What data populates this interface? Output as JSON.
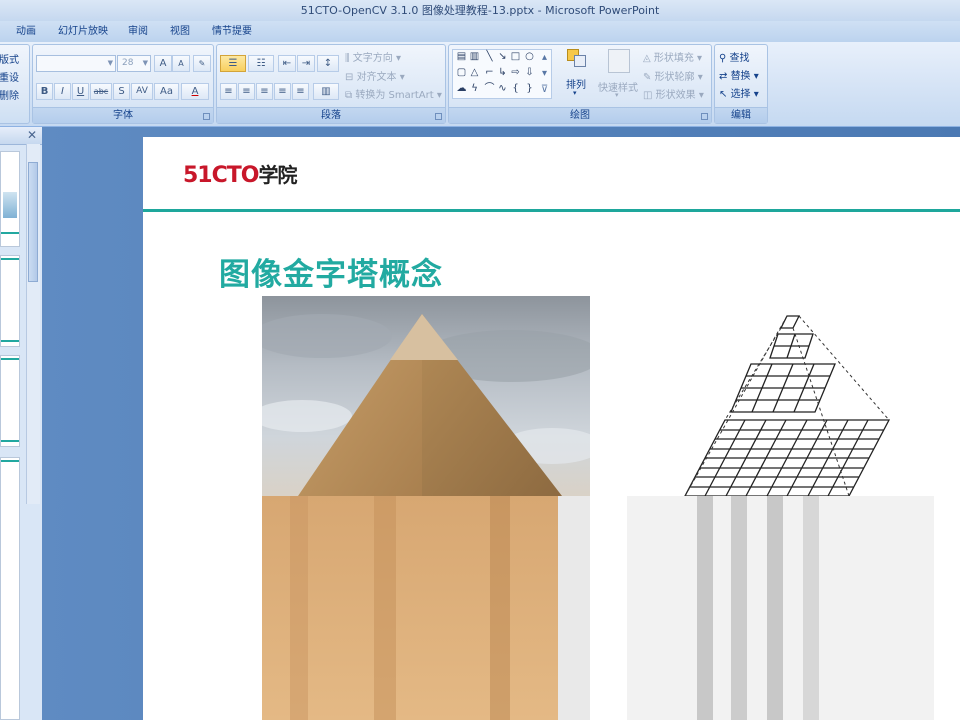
{
  "window": {
    "title": "51CTO-OpenCV 3.1.0 图像处理教程-13.pptx - Microsoft PowerPoint"
  },
  "tabs": [
    {
      "label": "动画"
    },
    {
      "label": "幻灯片放映"
    },
    {
      "label": "审阅"
    },
    {
      "label": "视图"
    },
    {
      "label": "情节提要"
    }
  ],
  "ribbon": {
    "slides_group": {
      "items": [
        "版式",
        "重设",
        "删除"
      ]
    },
    "font_group": {
      "label": "字体",
      "font_name": "",
      "font_size": "28",
      "buttons": {
        "bold": "B",
        "italic": "I",
        "underline": "U",
        "strike": "abc",
        "shadow": "S",
        "spacing": "AV",
        "case": "Aa",
        "color": "A",
        "grow": "A",
        "shrink": "A"
      }
    },
    "paragraph_group": {
      "label": "段落",
      "text_direction": "文字方向",
      "align_text": "对齐文本",
      "convert_smartart": "转换为 SmartArt"
    },
    "drawing_group": {
      "label": "绘图",
      "arrange": "排列",
      "quick_styles": "快速样式",
      "shape_fill": "形状填充",
      "shape_outline": "形状轮廓",
      "shape_effects": "形状效果"
    },
    "editing_group": {
      "label": "编辑",
      "find": "查找",
      "replace": "替换",
      "select": "选择"
    }
  },
  "slide": {
    "logo_number": "51CTO",
    "logo_text": "学院",
    "title": "图像金字塔概念"
  },
  "colors": {
    "accent_teal": "#22aaa1",
    "logo_red": "#c8172a"
  }
}
